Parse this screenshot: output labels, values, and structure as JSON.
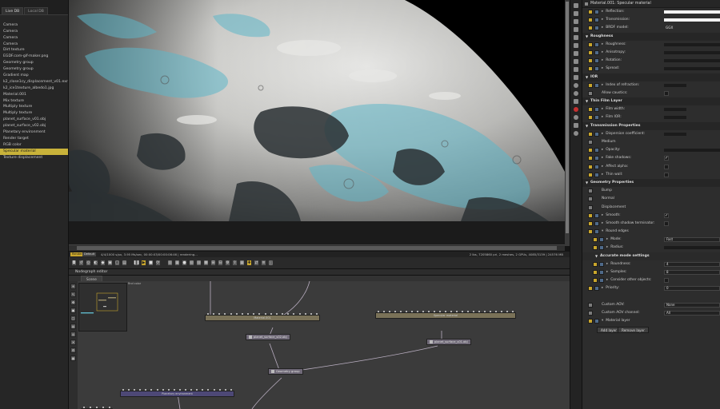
{
  "scene_panel": {
    "tabs": [
      "Live DB",
      "Local DB"
    ],
    "items": [
      {
        "label": "Camera"
      },
      {
        "label": "Camera"
      },
      {
        "label": "Camera"
      },
      {
        "label": "Camera"
      },
      {
        "label": "Dirt texture"
      },
      {
        "label": "EGDF.com-gif-maker.png"
      },
      {
        "label": "Geometry group"
      },
      {
        "label": "Geometry group"
      },
      {
        "label": "Gradient map"
      },
      {
        "label": "k2_close1cy_displacement_v01.exr"
      },
      {
        "label": "k2_ice1texture_albedo1.jpg"
      },
      {
        "label": "Material.001"
      },
      {
        "label": "Mix texture"
      },
      {
        "label": "Multiply texture"
      },
      {
        "label": "Multiply texture"
      },
      {
        "label": "planet_surface_v01.obj"
      },
      {
        "label": "planet_surface_v02.obj"
      },
      {
        "label": "Planetary environment"
      },
      {
        "label": "Render target"
      },
      {
        "label": "RGB color"
      },
      {
        "label": "Specular material",
        "selected": true
      },
      {
        "label": "Texture displacement"
      }
    ]
  },
  "viewport": {
    "status_left": "4/4/1000 s/px, 3.95 Ms/sec, 00:00:03/00:00:06:46 | rendering...",
    "status_right": "2 lbs, 7205860 pri, 2 meshes, 2 GPUs, 4085/3139 | 24576 MB",
    "status_tag_1": "Render",
    "status_tag_2": "Default"
  },
  "nodegraph": {
    "title": "Nodegraph editor",
    "tab": "Scene",
    "minimap_label": "Rnd color",
    "nodes": {
      "material": "Material.001",
      "specular": "Specular material",
      "surface_1": "planet_surface_v02.obj",
      "surface_2": "planet_surface_v01.obj",
      "geometry_group": "Geometry group",
      "environment": "Planetary environment"
    }
  },
  "inspector": {
    "title": "Material.001: Specular material",
    "rows_top": [
      {
        "label": "Reflection:",
        "kind": "white"
      },
      {
        "label": "Transmission:",
        "kind": "white"
      },
      {
        "label": "BRDF model:",
        "value": "GGX"
      }
    ],
    "sections": {
      "roughness": "Roughness",
      "ior": "IOR",
      "thin_film": "Thin Film Layer",
      "transmission": "Transmission Properties",
      "geometry": "Geometry Properties",
      "accurate": "Accurate mode settings"
    },
    "roughness_rows": [
      "Roughness:",
      "Anisotropy:",
      "Rotation:",
      "Spread:"
    ],
    "ior_rows": [
      "Index of refraction:",
      "Allow caustics:"
    ],
    "thin_film_rows": [
      "Film width:",
      "Film IOR:"
    ],
    "transmission_rows": [
      "Dispersion coefficient:",
      "Medium",
      "Opacity:",
      "Fake shadows:",
      "Affect alpha:",
      "Thin wall:"
    ],
    "geometry_rows": [
      "Bump",
      "Normal",
      "Displacement",
      "Smooth:",
      "Smooth shadow terminator:",
      "Round edges"
    ],
    "round_edges_rows": [
      {
        "label": "Mode:",
        "value": "Fast"
      },
      {
        "label": "Radius:"
      }
    ],
    "accurate_rows": [
      {
        "label": "Roundness:",
        "value": "4"
      },
      {
        "label": "Samples:",
        "value": "8"
      },
      {
        "label": "Consider other objects:"
      }
    ],
    "priority_label": "Priority:",
    "priority_value": "0",
    "custom_aov_label": "Custom AOV:",
    "custom_aov_value": "None",
    "custom_aov_channel_label": "Custom AOV channel:",
    "custom_aov_channel_value": "All",
    "material_layer_label": "Material layer",
    "add_layer": "Add layer",
    "remove_layer": "Remove layer",
    "fake_shadows_check": "✓",
    "smooth_check": "✓"
  },
  "colors": {
    "accent_yellow": "#c9a62c",
    "node_tan": "#7a7258",
    "node_purple": "#4d4876",
    "ice_blue": "#5fb7c9"
  }
}
